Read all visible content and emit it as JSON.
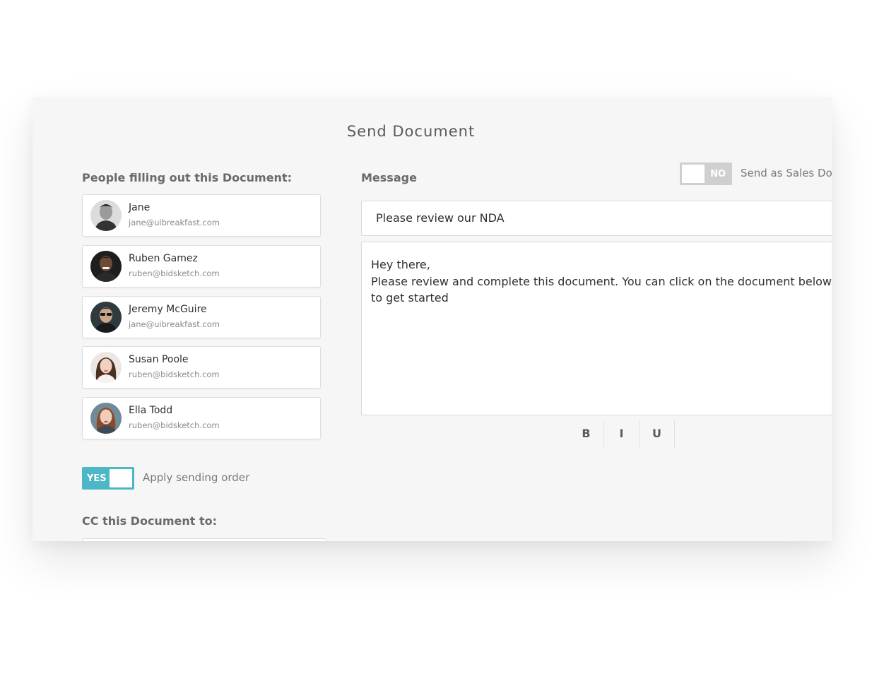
{
  "dialog": {
    "title": "Send Document"
  },
  "people": {
    "label": "People filling out this Document:",
    "items": [
      {
        "name": "Jane",
        "email": "jane@uibreakfast.com"
      },
      {
        "name": "Ruben Gamez",
        "email": "ruben@bidsketch.com"
      },
      {
        "name": "Jeremy McGuire",
        "email": "jane@uibreakfast.com"
      },
      {
        "name": "Susan Poole",
        "email": "ruben@bidsketch.com"
      },
      {
        "name": "Ella Todd",
        "email": "ruben@bidsketch.com"
      }
    ]
  },
  "sending_order": {
    "toggle_label": "YES",
    "text": "Apply sending order",
    "enabled": true
  },
  "cc": {
    "label": "CC this Document to:"
  },
  "message": {
    "label": "Message",
    "subject": "Please review our NDA",
    "body": "Hey there,\nPlease review and complete this document. You can click on the document below to get started"
  },
  "sales_doc": {
    "toggle_label": "NO",
    "text": "Send as Sales Document",
    "enabled": false
  },
  "formatting": {
    "bold": "B",
    "italic": "I",
    "underline": "U"
  },
  "colors": {
    "accent": "#4bb7c7",
    "toggle_off": "#cfcfcf",
    "panel_bg": "#f6f6f6"
  }
}
